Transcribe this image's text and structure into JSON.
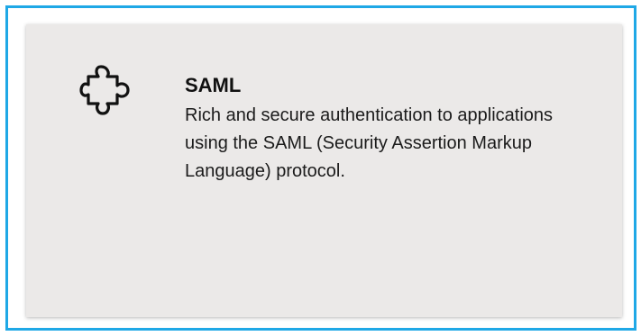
{
  "card": {
    "title": "SAML",
    "description": "Rich and secure authentication to applications using the SAML (Security Assertion Markup Language) protocol.",
    "icon": "puzzle-piece-icon",
    "selected": true
  },
  "colors": {
    "selection_border": "#1fa8e6",
    "card_background": "#ebe9e8"
  }
}
